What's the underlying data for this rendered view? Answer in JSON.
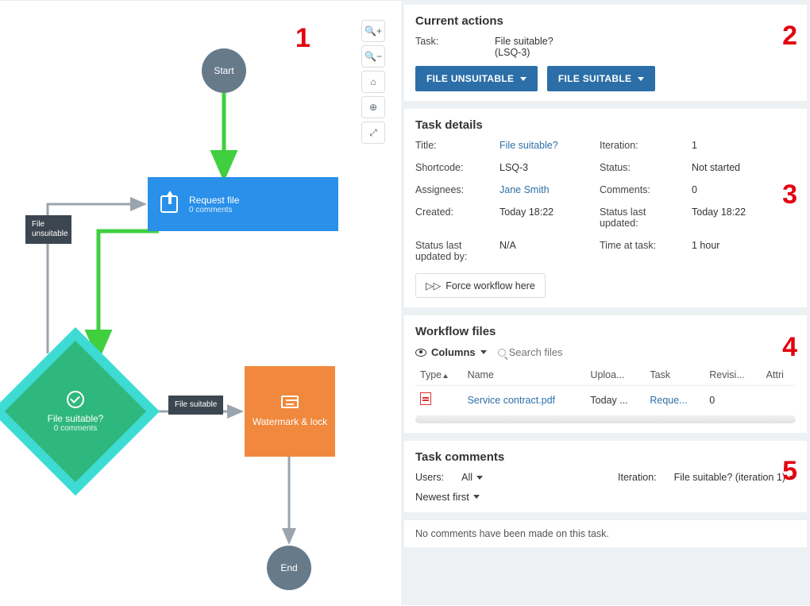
{
  "annotations": {
    "1": "1",
    "2": "2",
    "3": "3",
    "4": "4",
    "5": "5"
  },
  "flow": {
    "start": "Start",
    "end": "End",
    "request": {
      "title": "Request file",
      "sub": "0 comments"
    },
    "decision": {
      "title": "File suitable?",
      "sub": "0 comments"
    },
    "watermark": "Watermark & lock",
    "edge_unsuitable": "File unsuitable",
    "edge_suitable": "File suitable"
  },
  "current_actions": {
    "heading": "Current actions",
    "task_label": "Task:",
    "task_name": "File suitable?",
    "task_code": "(LSQ-3)",
    "btn_unsuitable": "FILE UNSUITABLE",
    "btn_suitable": "FILE SUITABLE"
  },
  "task_details": {
    "heading": "Task details",
    "labels": {
      "title": "Title:",
      "shortcode": "Shortcode:",
      "assignees": "Assignees:",
      "created": "Created:",
      "status_by": "Status last updated by:",
      "iteration": "Iteration:",
      "status": "Status:",
      "comments": "Comments:",
      "status_updated": "Status last updated:",
      "time_at_task": "Time at task:"
    },
    "values": {
      "title": "File suitable?",
      "shortcode": "LSQ-3",
      "assignees": "Jane Smith",
      "created": "Today 18:22",
      "status_by": "N/A",
      "iteration": "1",
      "status": "Not started",
      "comments": "0",
      "status_updated": "Today 18:22",
      "time_at_task": "1 hour"
    },
    "force_btn": "Force workflow here"
  },
  "workflow_files": {
    "heading": "Workflow files",
    "columns_btn": "Columns",
    "search_placeholder": "Search files",
    "headers": {
      "type": "Type",
      "name": "Name",
      "uploaded": "Uploa...",
      "task": "Task",
      "revision": "Revisi...",
      "attr": "Attri"
    },
    "row": {
      "name": "Service contract.pdf",
      "uploaded": "Today ...",
      "task": "Reque...",
      "revision": "0"
    }
  },
  "task_comments": {
    "heading": "Task comments",
    "users_label": "Users:",
    "users_value": "All",
    "iteration_label": "Iteration:",
    "iteration_value": "File suitable? (iteration 1)",
    "sort": "Newest first",
    "empty": "No comments have been made on this task."
  }
}
